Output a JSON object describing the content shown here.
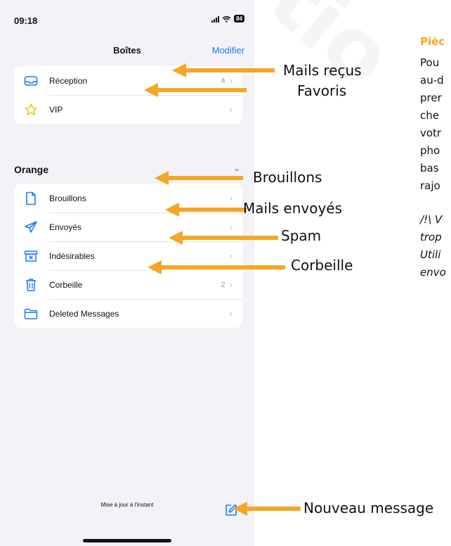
{
  "status_bar": {
    "time": "09:18",
    "battery": "84"
  },
  "nav": {
    "title": "Boîtes",
    "edit": "Modifier"
  },
  "top_card": [
    {
      "label": "Réception",
      "count": "4",
      "icon": "inbox-icon"
    },
    {
      "label": "VIP",
      "count": "",
      "icon": "star-icon"
    }
  ],
  "section": {
    "title": "Orange",
    "chevron": "chevron-down-icon"
  },
  "account_card": [
    {
      "label": "Brouillons",
      "count": "",
      "icon": "document-icon"
    },
    {
      "label": "Envoyés",
      "count": "",
      "icon": "paper-plane-icon"
    },
    {
      "label": "Indésirables",
      "count": "",
      "icon": "junk-box-icon"
    },
    {
      "label": "Corbeille",
      "count": "2",
      "icon": "trash-icon"
    },
    {
      "label": "Deleted Messages",
      "count": "",
      "icon": "folder-icon"
    }
  ],
  "footer": {
    "status": "Mise à jour à l'instant"
  },
  "annotations": {
    "mails_recus": "Mails reçus",
    "favoris": "Favoris",
    "brouillons": "Brouillons",
    "mails_envoyes": "Mails envoyés",
    "spam": "Spam",
    "corbeille": "Corbeille",
    "nouveau_message": "Nouveau message"
  },
  "side_text": {
    "heading": "Pièc",
    "lines": [
      "Pou",
      "au-d",
      "prer",
      "che",
      "votr",
      "pho",
      "bas",
      "rajo"
    ],
    "italic_lines": [
      "/!\\ V",
      "trop",
      "Utili",
      "envo"
    ]
  },
  "colors": {
    "accent": "#1a7cf5",
    "arrow": "#f5a623",
    "heading": "#f5a623"
  }
}
